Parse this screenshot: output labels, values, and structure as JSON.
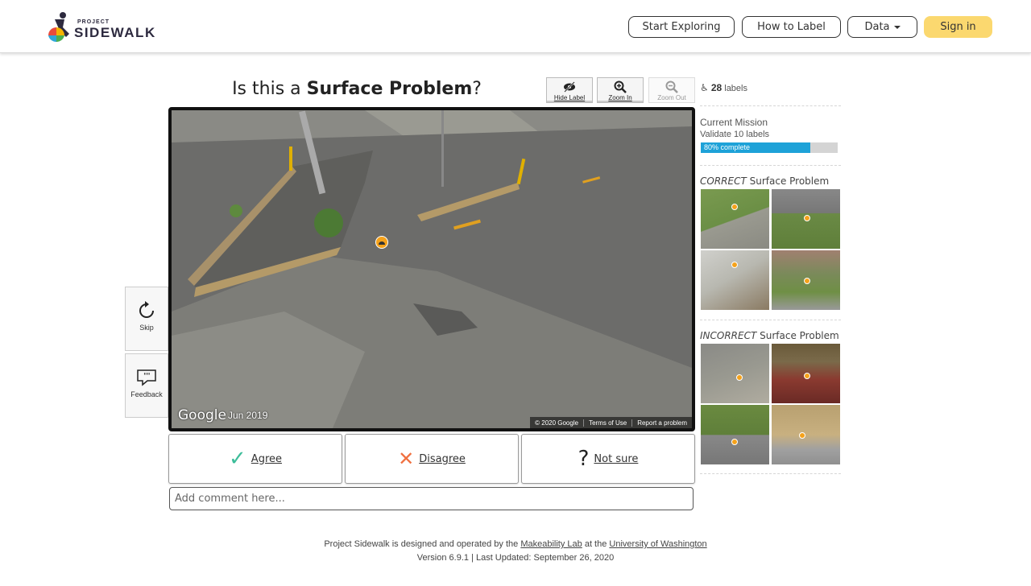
{
  "header": {
    "logo_small": "PROJECT",
    "logo_big": "SIDEWALK",
    "nav": {
      "start_exploring": "Start Exploring",
      "how_to_label": "How to Label",
      "data": "Data",
      "sign_in": "Sign in"
    },
    "colors": {
      "signin_bg": "#fbd86f"
    }
  },
  "task": {
    "question_prefix": "Is this a ",
    "question_bold": "Surface Problem",
    "question_suffix": "?",
    "tools": {
      "hide_label": "Hide Label",
      "zoom_in": "Zoom In",
      "zoom_out": "Zoom Out"
    }
  },
  "pano": {
    "watermark": "Google",
    "date": "Jun 2019",
    "footer": [
      "© 2020 Google",
      "Terms of Use",
      "Report a problem"
    ]
  },
  "side": {
    "skip": "Skip",
    "feedback": "Feedback"
  },
  "verdict": {
    "agree": "Agree",
    "disagree": "Disagree",
    "not_sure": "Not sure"
  },
  "comment": {
    "placeholder": "Add comment here..."
  },
  "panel": {
    "label_count": "28",
    "label_count_suffix": "labels",
    "mission_title": "Current Mission",
    "mission_sub": "Validate 10 labels",
    "progress_text": "80% complete",
    "progress_fraction": 0.8,
    "correct_prefix": "CORRECT",
    "correct_suffix": " Surface Problem",
    "incorrect_prefix": "INCORRECT",
    "incorrect_suffix": " Surface Problem",
    "progress_color": "#1ea2d8"
  },
  "footer": {
    "line1_a": "Project Sidewalk is designed and operated by the ",
    "line1_link1": "Makeability Lab",
    "line1_b": " at the ",
    "line1_link2": "University of Washington",
    "line2": "Version 6.9.1 | Last Updated: September 26, 2020"
  }
}
